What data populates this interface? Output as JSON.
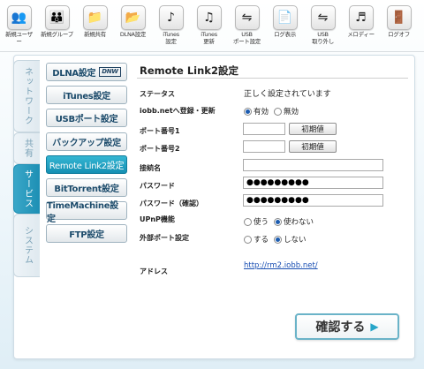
{
  "toolbar": [
    {
      "label": "新規ユーザー",
      "icon": "user-icon",
      "glyph": "👥"
    },
    {
      "label": "新規グループ",
      "icon": "group-icon",
      "glyph": "👪"
    },
    {
      "label": "新規共有",
      "icon": "folder-icon",
      "glyph": "📁"
    },
    {
      "label": "DLNA設定",
      "icon": "dlna-icon",
      "glyph": "📂"
    },
    {
      "label": "iTunes\n設定",
      "icon": "itunes-icon",
      "glyph": "♪"
    },
    {
      "label": "iTunes\n更新",
      "icon": "itunes-refresh-icon",
      "glyph": "♫"
    },
    {
      "label": "USB\nポート設定",
      "icon": "usb-icon",
      "glyph": "⇋"
    },
    {
      "label": "ログ表示",
      "icon": "log-icon",
      "glyph": "📄"
    },
    {
      "label": "USB\n取り外し",
      "icon": "usb-remove-icon",
      "glyph": "⇋"
    },
    {
      "label": "メロディー",
      "icon": "melody-icon",
      "glyph": "♬"
    },
    {
      "label": "ログオフ",
      "icon": "logoff-icon",
      "glyph": "🚪"
    }
  ],
  "vtabs": [
    {
      "label": "ネットワーク",
      "active": false
    },
    {
      "label": "共有",
      "active": false
    },
    {
      "label": "サービス",
      "active": true
    },
    {
      "label": "システム",
      "active": false
    }
  ],
  "menu": {
    "dlna": "DLNA設定",
    "dlna_logo": "DNW",
    "itunes": "iTunes設定",
    "usb": "USBポート設定",
    "backup": "バックアップ設定",
    "remotelink": "Remote Link2設定",
    "bittorrent": "BitTorrent設定",
    "timemachine": "TimeMachine設定",
    "ftp": "FTP設定"
  },
  "page": {
    "title": "Remote Link2設定",
    "status_label": "ステータス",
    "status_value": "正しく設定されています",
    "iobb_label": "iobb.netへ登録・更新",
    "iobb_on": "有効",
    "iobb_off": "無効",
    "port1_label": "ポート番号1",
    "port1_value": "",
    "port2_label": "ポート番号2",
    "port2_value": "",
    "default_btn": "初期値",
    "conn_label": "接続名",
    "conn_value": "",
    "pass_label": "パスワード",
    "pass_value": "●●●●●●●●●",
    "pass_confirm_label": "パスワード（確認）",
    "pass_confirm_value": "●●●●●●●●●",
    "upnp_label": "UPnP機能",
    "upnp_use": "使う",
    "upnp_nouse": "使わない",
    "ext_port_label": "外部ポート設定",
    "ext_do": "する",
    "ext_dont": "しない",
    "address_label": "アドレス",
    "address_link": "http://rm2.iobb.net/",
    "confirm": "確認する"
  }
}
